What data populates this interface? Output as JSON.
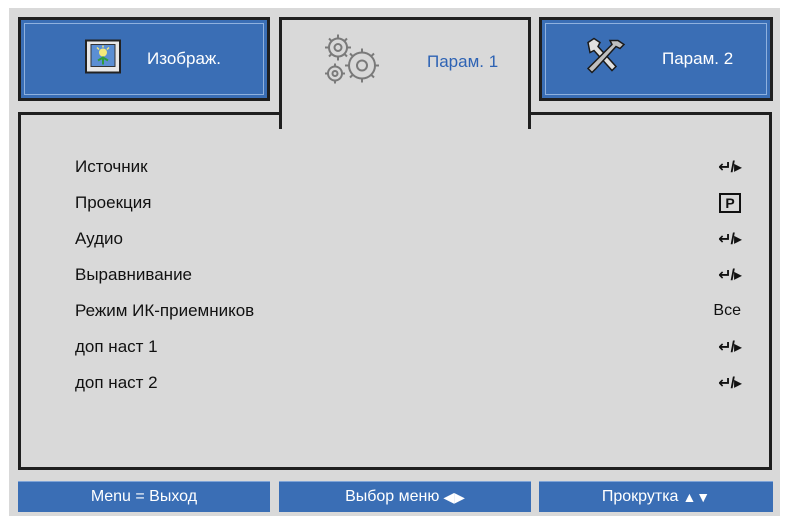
{
  "tabs": [
    {
      "label": "Изображ.",
      "icon": "image-icon",
      "active": false
    },
    {
      "label": "Парам. 1",
      "icon": "gears-icon",
      "active": true
    },
    {
      "label": "Парам. 2",
      "icon": "tools-icon",
      "active": false
    }
  ],
  "menu": {
    "items": [
      {
        "label": "Источник",
        "value": "↵/▸",
        "type": "enter"
      },
      {
        "label": "Проекция",
        "value": "P",
        "type": "box"
      },
      {
        "label": "Аудио",
        "value": "↵/▸",
        "type": "enter"
      },
      {
        "label": "Выравнивание",
        "value": "↵/▸",
        "type": "enter"
      },
      {
        "label": "Режим ИК-приемников",
        "value": "Все",
        "type": "text"
      },
      {
        "label": "доп наст 1",
        "value": "↵/▸",
        "type": "enter"
      },
      {
        "label": "доп наст 2",
        "value": "↵/▸",
        "type": "enter"
      }
    ]
  },
  "footer": {
    "exit": "Menu = Выход",
    "select": "Выбор меню",
    "select_arrows": "◀▶",
    "scroll": "Прокрутка",
    "scroll_arrows": "▲▼"
  },
  "colors": {
    "accent_blue": "#3a6eb5",
    "panel_gray": "#d9d9d9",
    "active_text": "#2e63b4"
  }
}
